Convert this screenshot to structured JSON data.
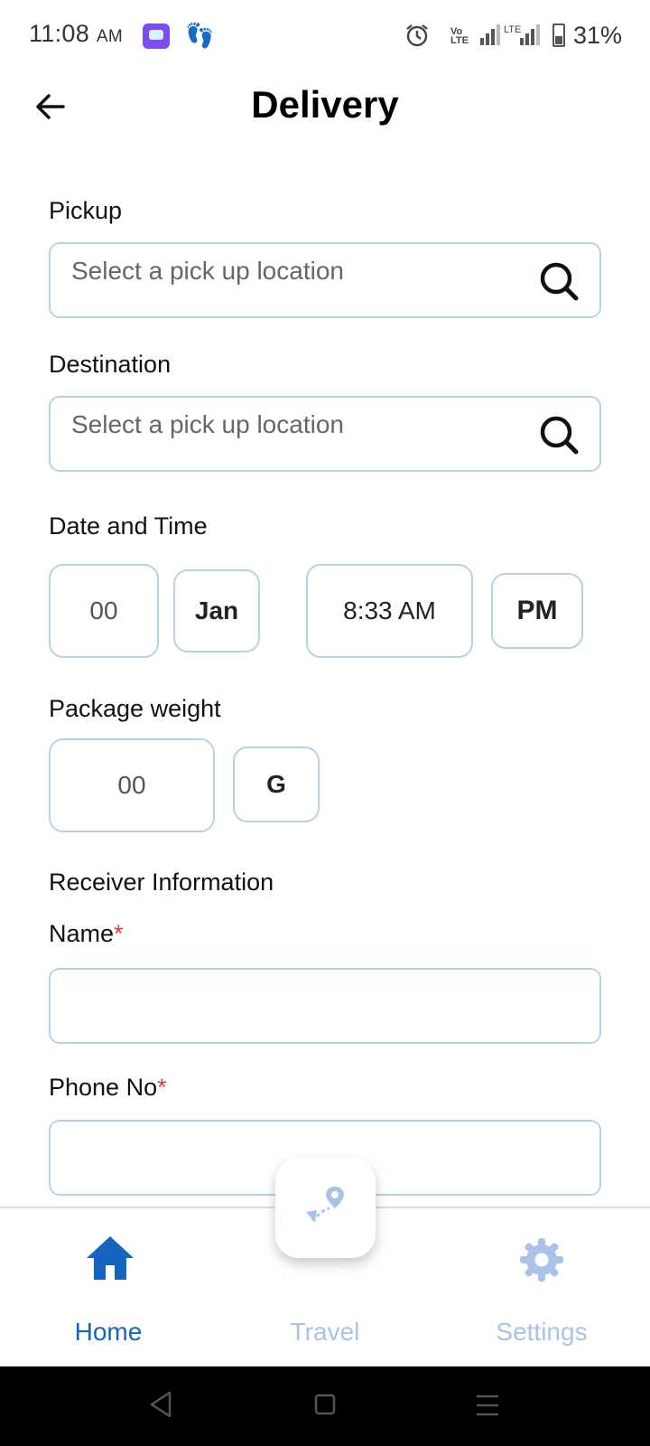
{
  "status_bar": {
    "time": "11:08",
    "time_suffix": "AM",
    "network": "LTE",
    "volte": "Vo LTE",
    "battery": "31%"
  },
  "header": {
    "title": "Delivery"
  },
  "form": {
    "pickup": {
      "label": "Pickup",
      "placeholder": "Select a pick up location"
    },
    "destination": {
      "label": "Destination",
      "placeholder": "Select a pick up location"
    },
    "date_time": {
      "label": "Date and Time",
      "day": "00",
      "month": "Jan",
      "time": "8:33 AM",
      "period": "PM"
    },
    "package_weight": {
      "label": "Package weight",
      "value": "00",
      "unit": "G"
    },
    "receiver": {
      "section_label": "Receiver Information",
      "name_label": "Name",
      "phone_label": "Phone No",
      "required_mark": "*",
      "name_value": "",
      "phone_value": ""
    }
  },
  "bottom_nav": {
    "items": [
      {
        "label": "Home",
        "icon": "home-icon",
        "active": true
      },
      {
        "label": "Travel",
        "icon": "route-icon",
        "active": false
      },
      {
        "label": "Settings",
        "icon": "gear-icon",
        "active": false
      }
    ]
  },
  "colors": {
    "accent": "#1565c0",
    "inactive_nav": "#a9c3e8",
    "field_border": "#b9d2e6",
    "required": "#e53935"
  }
}
